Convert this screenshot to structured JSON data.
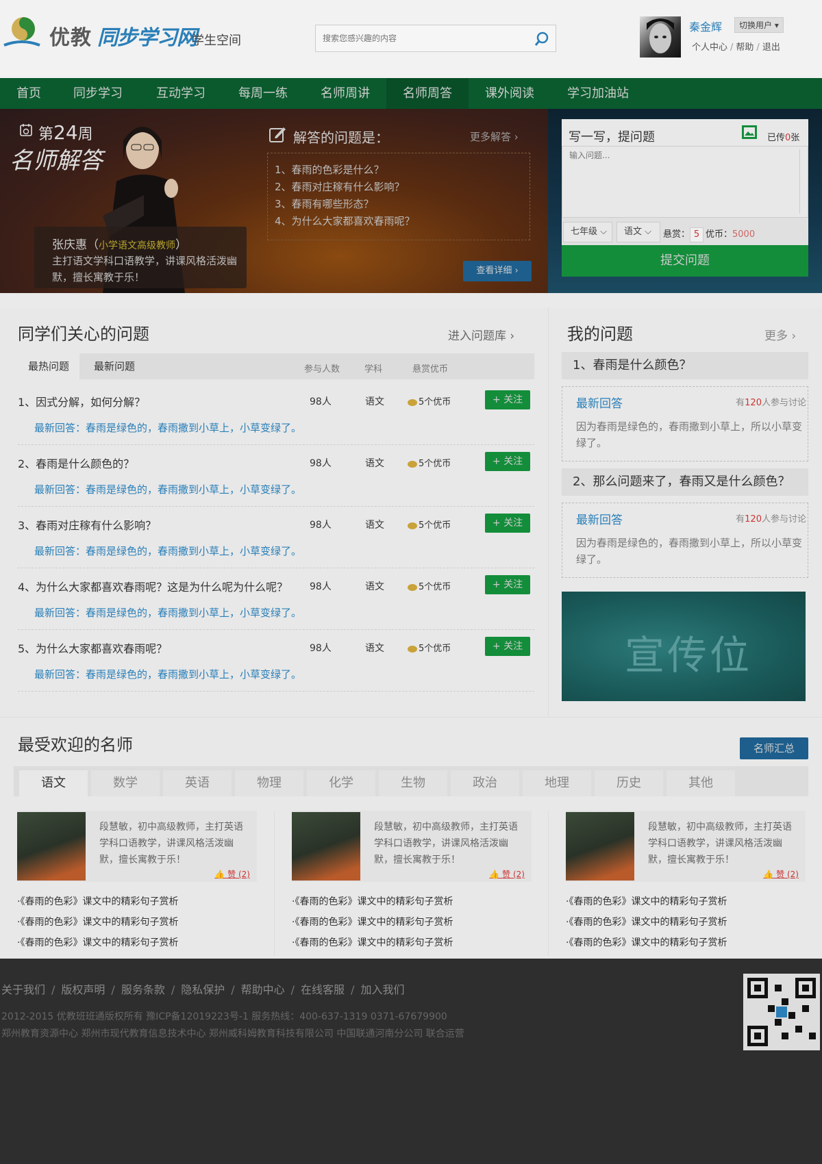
{
  "header": {
    "logo_youjiao": "优教",
    "logo_tongbu": "同步学习网",
    "logo_space": "学生空间",
    "search_placeholder": "搜索您感兴趣的内容",
    "user_name": "秦金辉",
    "switch_user": "切换用户",
    "links": [
      "个人中心",
      "帮助",
      "退出"
    ]
  },
  "nav": [
    "首页",
    "同步学习",
    "互动学习",
    "每周一练",
    "名师周讲",
    "名师周答",
    "课外阅读",
    "学习加油站"
  ],
  "nav_active_index": 5,
  "banner": {
    "week_prefix": "第",
    "week_num": "24",
    "week_suffix": "周",
    "art_title": "名师解答",
    "teacher_name": "张庆惠",
    "teacher_role": "小学语文高级教师",
    "teacher_desc": "主打语文学科口语教学，讲课风格活泼幽默，擅长寓教于乐！",
    "q_heading": "解答的问题是：",
    "more_answers": "更多解答",
    "questions": [
      "1、春雨的色彩是什么？",
      "2、春雨对庄稼有什么影响？",
      "3、春雨有哪些形态？",
      "4、为什么大家都喜欢春雨呢？"
    ],
    "detail_button": "查看详细"
  },
  "ask": {
    "title": "写一写，提问题",
    "uploaded_prefix": "已传",
    "uploaded_count": "0",
    "uploaded_suffix": "张",
    "placeholder": "输入问题...",
    "grade": "七年级",
    "subject": "语文",
    "reward_label": "悬赏：",
    "reward_value": "5",
    "coins_label": "优币：",
    "coins_value": "5000",
    "submit": "提交问题"
  },
  "hot": {
    "title": "同学们关心的问题",
    "more": "进入问题库",
    "tabs": [
      "最热问题",
      "最新问题"
    ],
    "columns": [
      "参与人数",
      "学科",
      "悬赏优币"
    ],
    "rows": [
      {
        "q": "1、因式分解，如何分解？",
        "count": "98人",
        "subject": "语文",
        "coin": "5个优币",
        "follow": "+ 关注",
        "answer": "最新回答：春雨是绿色的，春雨撒到小草上，小草变绿了。"
      },
      {
        "q": "2、春雨是什么颜色的？",
        "count": "98人",
        "subject": "语文",
        "coin": "5个优币",
        "follow": "+ 关注",
        "answer": "最新回答：春雨是绿色的，春雨撒到小草上，小草变绿了。"
      },
      {
        "q": "3、春雨对庄稼有什么影响？",
        "count": "98人",
        "subject": "语文",
        "coin": "5个优币",
        "follow": "+ 关注",
        "answer": "最新回答：春雨是绿色的，春雨撒到小草上，小草变绿了。"
      },
      {
        "q": "4、为什么大家都喜欢春雨呢？这是为什么呢为什么呢？",
        "count": "98人",
        "subject": "语文",
        "coin": "5个优币",
        "follow": "+ 关注",
        "answer": "最新回答：春雨是绿色的，春雨撒到小草上，小草变绿了。"
      },
      {
        "q": "5、为什么大家都喜欢春雨呢？",
        "count": "98人",
        "subject": "语文",
        "coin": "5个优币",
        "follow": "+ 关注",
        "answer": "最新回答：春雨是绿色的，春雨撒到小草上，小草变绿了。"
      }
    ]
  },
  "mine": {
    "title": "我的问题",
    "more": "更多",
    "items": [
      {
        "q": "1、春雨是什么颜色？",
        "label": "最新回答",
        "disc_prefix": "有",
        "disc_num": "120",
        "disc_suffix": "人参与讨论",
        "text": "因为春雨是绿色的，春雨撒到小草上，所以小草变绿了。"
      },
      {
        "q": "2、那么问题来了，春雨又是什么颜色？",
        "label": "最新回答",
        "disc_prefix": "有",
        "disc_num": "120",
        "disc_suffix": "人参与讨论",
        "text": "因为春雨是绿色的，春雨撒到小草上，所以小草变绿了。"
      }
    ],
    "ad_text": "宣传位"
  },
  "teachers": {
    "title": "最受欢迎的名师",
    "summary": "名师汇总",
    "subjects": [
      "语文",
      "数学",
      "英语",
      "物理",
      "化学",
      "生物",
      "政治",
      "地理",
      "历史",
      "其他"
    ],
    "cards": [
      {
        "desc": "段慧敏，初中高级教师，主打英语学科口语教学，讲课风格活泼幽默，擅长寓教于乐！",
        "like": "赞 (2)",
        "links": [
          "·《春雨的色彩》课文中的精彩句子赏析",
          "·《春雨的色彩》课文中的精彩句子赏析",
          "·《春雨的色彩》课文中的精彩句子赏析"
        ]
      },
      {
        "desc": "段慧敏，初中高级教师，主打英语学科口语教学，讲课风格活泼幽默，擅长寓教于乐！",
        "like": "赞 (2)",
        "links": [
          "·《春雨的色彩》课文中的精彩句子赏析",
          "·《春雨的色彩》课文中的精彩句子赏析",
          "·《春雨的色彩》课文中的精彩句子赏析"
        ]
      },
      {
        "desc": "段慧敏，初中高级教师，主打英语学科口语教学，讲课风格活泼幽默，擅长寓教于乐！",
        "like": "赞 (2)",
        "links": [
          "·《春雨的色彩》课文中的精彩句子赏析",
          "·《春雨的色彩》课文中的精彩句子赏析",
          "·《春雨的色彩》课文中的精彩句子赏析"
        ]
      }
    ]
  },
  "footer": {
    "links": [
      "关于我们",
      "版权声明",
      "服务条款",
      "隐私保护",
      "帮助中心",
      "在线客服",
      "加入我们"
    ],
    "copyright": "2012-2015 优教班班通版权所有  豫ICP备12019223号-1     服务热线：400-637-1319   0371-67679900",
    "companies": "郑州教育资源中心    郑州市现代教育信息技术中心    郑州威科姆教育科技有限公司 中国联通河南分公司  联合运营"
  }
}
